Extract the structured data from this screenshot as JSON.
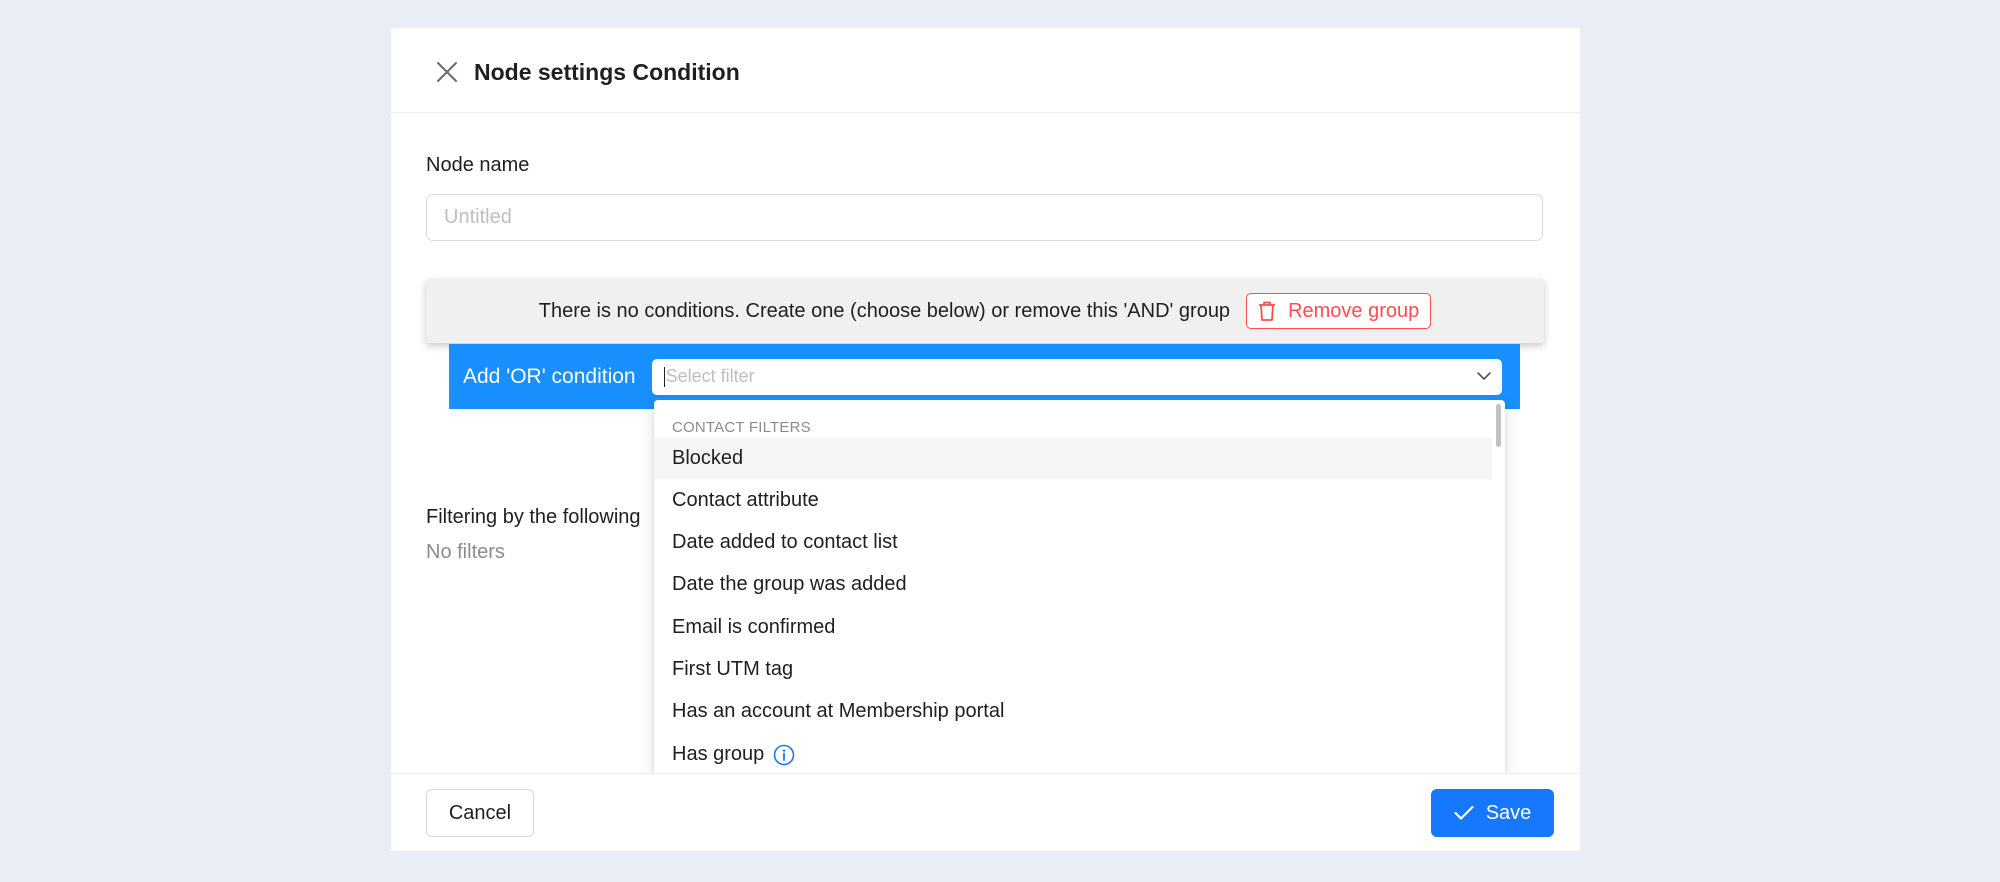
{
  "modal": {
    "title": "Node settings Condition"
  },
  "node_name": {
    "label": "Node name",
    "placeholder": "Untitled",
    "value": ""
  },
  "and_group": {
    "message": "There is no conditions. Create one (choose below) or remove this 'AND' group",
    "remove_label": "Remove group"
  },
  "or_condition": {
    "label": "Add 'OR' condition",
    "select_placeholder": "Select filter"
  },
  "filters": {
    "label": "Filtering by the following",
    "empty_text": "No filters"
  },
  "dropdown": {
    "group_label": "CONTACT FILTERS",
    "items": [
      {
        "label": "Blocked"
      },
      {
        "label": "Contact attribute"
      },
      {
        "label": "Date added to contact list"
      },
      {
        "label": "Date the group was added"
      },
      {
        "label": "Email is confirmed"
      },
      {
        "label": "First UTM tag"
      },
      {
        "label": "Has an account at Membership portal"
      },
      {
        "label": "Has group"
      }
    ]
  },
  "footer": {
    "cancel_label": "Cancel",
    "save_label": "Save"
  },
  "colors": {
    "primary": "#1677ff",
    "or_bar": "#1890ff",
    "danger": "#ff4d4f",
    "background": "#e9edf5"
  }
}
